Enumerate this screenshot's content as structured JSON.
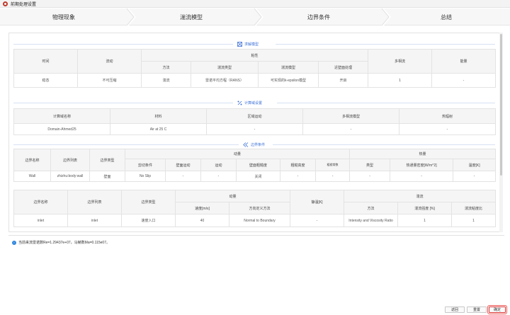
{
  "window": {
    "title": "前期处理设置"
  },
  "wizard": {
    "steps": [
      "物理现象",
      "湍流模型",
      "边界条件",
      "总结"
    ]
  },
  "solver_section": {
    "title": "求解模型",
    "header_row1": {
      "time": "时间",
      "flow": "流动",
      "viscous": "粘性",
      "multiphase": "多相流",
      "energy": "能量"
    },
    "header_row2": {
      "method": "方法",
      "turb_type": "湍流类型",
      "turb_model": "湍流模型",
      "near_wall": "近壁面处理"
    },
    "row": {
      "time": "稳态",
      "flow": "不可压缩",
      "method": "湍流",
      "turb_type": "雷诺平均方程（RANS）",
      "turb_model": "可实现的k-epsilon模型",
      "near_wall": "开启",
      "multiphase": "1",
      "energy": "-"
    }
  },
  "domain_section": {
    "title": "计算域设置",
    "headers": [
      "计算域名称",
      "材料",
      "区域运动",
      "多相流模型",
      "热辐射"
    ],
    "row": [
      "Domain-Ahmed25",
      "Air at 25 C",
      "-",
      "-",
      "-"
    ]
  },
  "boundary_section": {
    "title": "边界条件",
    "wall_table": {
      "group_momentum": "动量",
      "group_heat": "热量",
      "fixed_headers": [
        "边界名称",
        "边界列表",
        "边界类型"
      ],
      "momentum_headers": [
        "剪切条件",
        "壁面运动",
        "运动",
        "壁面粗糙度",
        "粗糙高度",
        "粗糙常数"
      ],
      "heat_headers": [
        "类型",
        "热通量密度[W/m^2]",
        "温度[K]"
      ],
      "row": [
        "Wall",
        "zhizhu:body:wall",
        "壁面",
        "No Slip",
        "-",
        "-",
        "关闭",
        "-",
        "-",
        "-",
        "-",
        "-"
      ]
    },
    "inlet_table": {
      "fixed_headers": [
        "边界名称",
        "边界列表",
        "边界类型"
      ],
      "group_momentum": "动量",
      "momentum_headers": [
        "速度[m/s]",
        "方向定义方法"
      ],
      "static_temp": "静温[K]",
      "group_turb": "湍流",
      "turb_headers": [
        "方法",
        "湍流强度 [%]",
        "湍流粘度比"
      ],
      "row": [
        "inlet",
        "inlet",
        "速度入口",
        "40",
        "Normal to Boundary",
        "-",
        "Intensity and Viscosity Ratio",
        "1",
        "1"
      ]
    }
  },
  "console": {
    "message": "当前来流雷诺数Re=1.29437e+07，马赫数Ma=0.115e07。"
  },
  "buttons": {
    "back": "返回",
    "reset": "重置",
    "ok": "确定"
  },
  "colors": {
    "accent": "#3a6fd8",
    "header_bg": "#f5f5f5",
    "ok_border": "#dd3333"
  }
}
